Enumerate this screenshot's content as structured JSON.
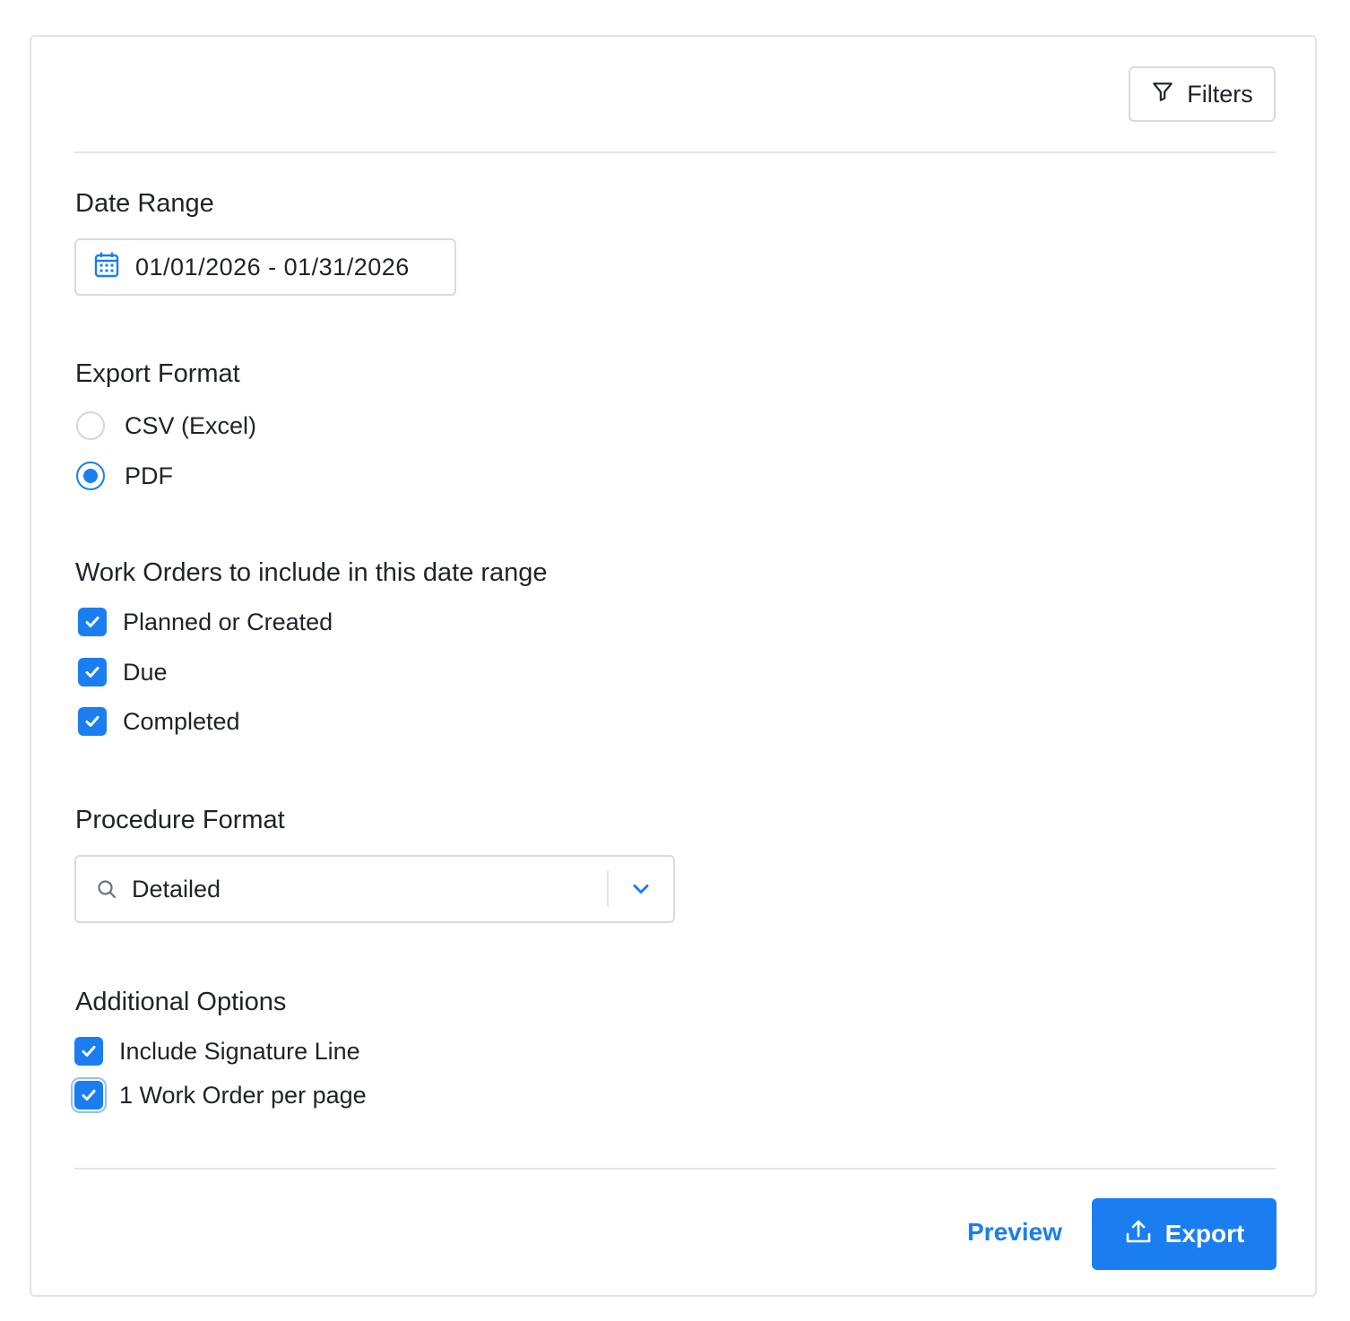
{
  "header": {
    "filters_label": "Filters",
    "filters_icon": "filter-icon"
  },
  "date_range": {
    "title": "Date Range",
    "value": "01/01/2026 - 01/31/2026",
    "icon": "calendar-icon"
  },
  "export_format": {
    "title": "Export Format",
    "options": [
      {
        "label": "CSV (Excel)",
        "selected": false
      },
      {
        "label": "PDF",
        "selected": true
      }
    ]
  },
  "work_orders": {
    "title": "Work Orders to include in this date range",
    "options": [
      {
        "label": "Planned or Created",
        "checked": true
      },
      {
        "label": "Due",
        "checked": true
      },
      {
        "label": "Completed",
        "checked": true
      }
    ]
  },
  "procedure_format": {
    "title": "Procedure Format",
    "value": "Detailed",
    "icon": "search-icon"
  },
  "additional_options": {
    "title": "Additional Options",
    "options": [
      {
        "label": "Include Signature Line",
        "checked": true
      },
      {
        "label": "1 Work Order per page",
        "checked": true
      }
    ]
  },
  "footer": {
    "preview_label": "Preview",
    "export_label": "Export",
    "export_icon": "upload-icon"
  },
  "colors": {
    "accent": "#1a7ef0",
    "border": "#d7dadf",
    "divider": "#e1e3e6",
    "text": "#1f2329"
  }
}
